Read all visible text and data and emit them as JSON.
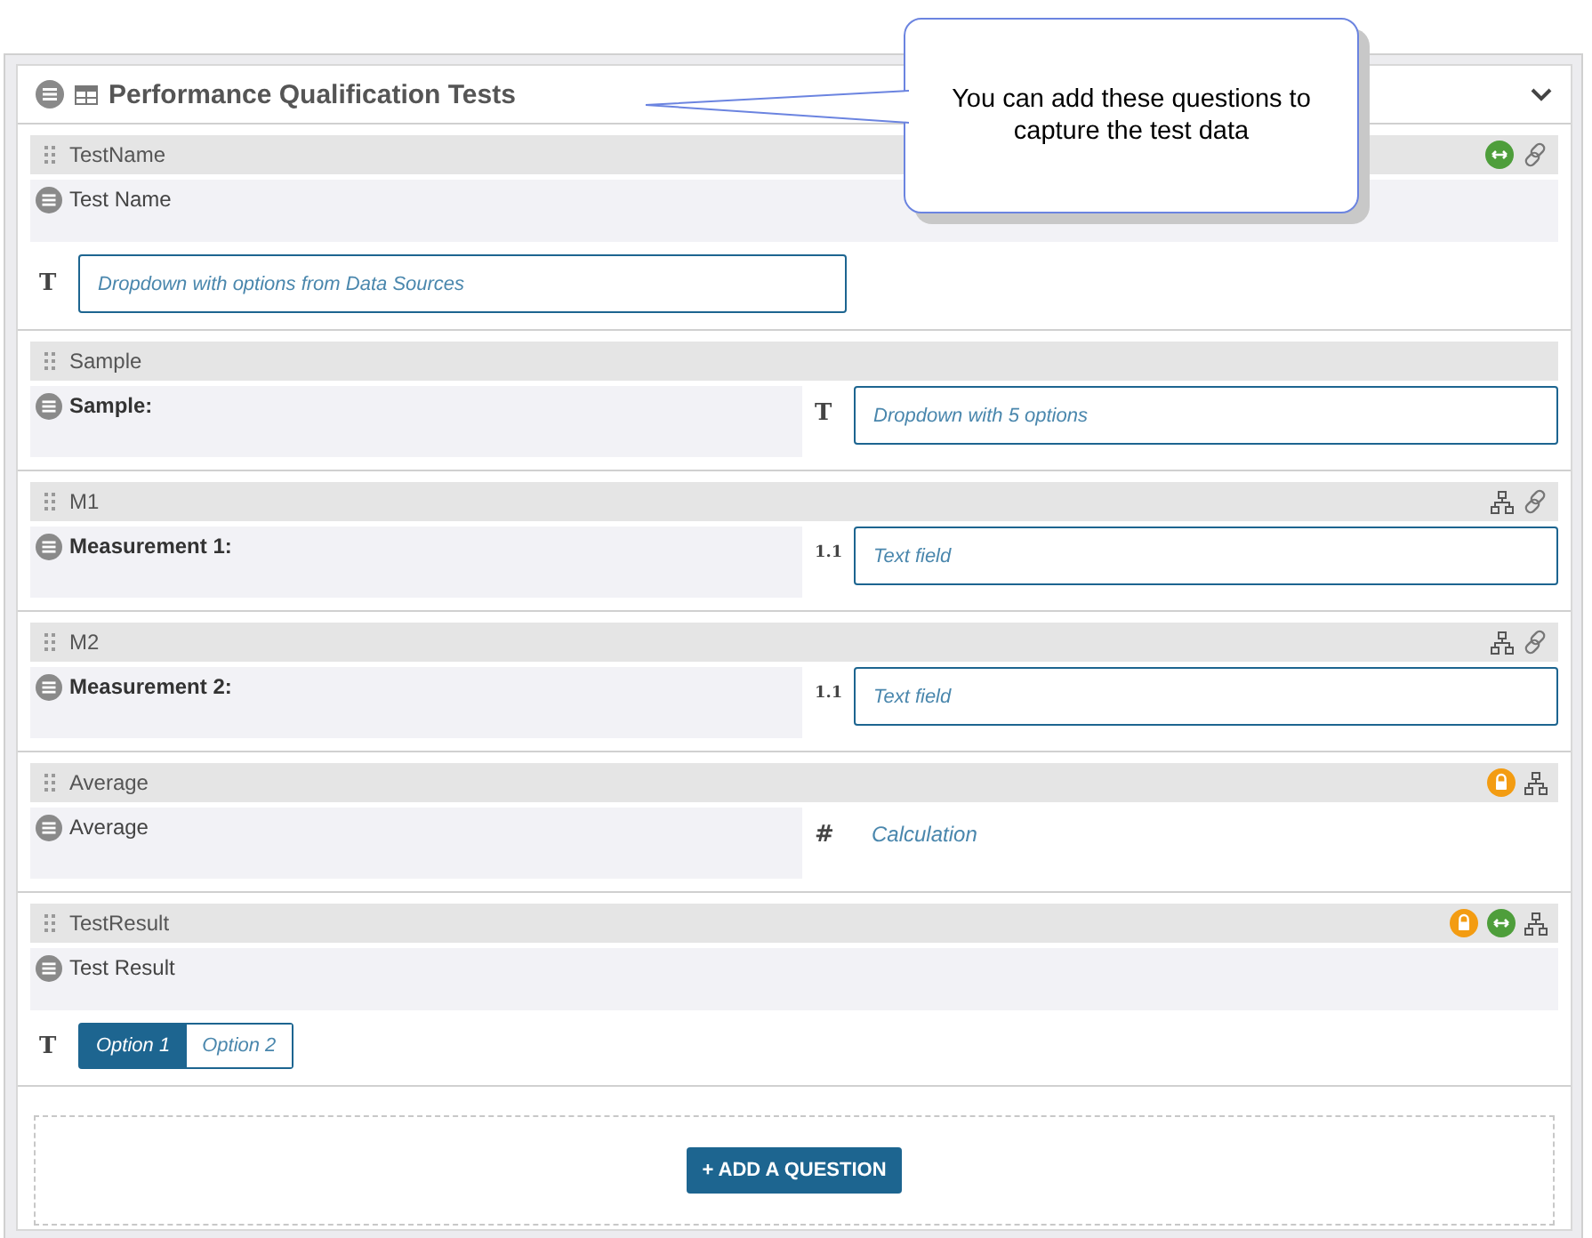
{
  "section": {
    "title": "Performance Qualification Tests",
    "expanded": true
  },
  "callout": {
    "text": "You can add these questions to capture the test data"
  },
  "questions": [
    {
      "name": "TestName",
      "label": "Test Name",
      "label_bold": false,
      "answer_beside": false,
      "badges": [
        {
          "kind": "range"
        },
        {
          "kind": "link"
        }
      ],
      "answer": {
        "kind": "dropdown",
        "type_mark": "T",
        "placeholder": "Dropdown with options from Data Sources"
      }
    },
    {
      "name": "Sample",
      "label": "Sample:",
      "label_bold": true,
      "answer_beside": true,
      "answer": {
        "kind": "dropdown",
        "type_mark": "T",
        "placeholder": "Dropdown with 5 options"
      }
    },
    {
      "name": "M1",
      "label": "Measurement 1:",
      "label_bold": true,
      "answer_beside": true,
      "badges": [
        {
          "kind": "hierarchy"
        },
        {
          "kind": "link"
        }
      ],
      "answer": {
        "kind": "text",
        "type_mark": "1.1",
        "placeholder": "Text field"
      }
    },
    {
      "name": "M2",
      "label": "Measurement 2:",
      "label_bold": true,
      "answer_beside": true,
      "badges": [
        {
          "kind": "hierarchy"
        },
        {
          "kind": "link"
        }
      ],
      "answer": {
        "kind": "text",
        "type_mark": "1.1",
        "placeholder": "Text field"
      }
    },
    {
      "name": "Average",
      "label": "Average",
      "label_bold": false,
      "answer_beside": true,
      "badges": [
        {
          "kind": "lock"
        },
        {
          "kind": "hierarchy"
        }
      ],
      "answer": {
        "kind": "calculation",
        "type_mark": "#",
        "placeholder": "Calculation"
      }
    },
    {
      "name": "TestResult",
      "label": "Test Result",
      "label_bold": false,
      "answer_beside": false,
      "badges": [
        {
          "kind": "lock"
        },
        {
          "kind": "range"
        },
        {
          "kind": "hierarchy"
        }
      ],
      "answer": {
        "kind": "options",
        "type_mark": "T",
        "options": [
          {
            "label": "Option 1",
            "selected": true
          },
          {
            "label": "Option 2",
            "selected": false
          }
        ]
      }
    }
  ],
  "add_button": "+ ADD A QUESTION"
}
